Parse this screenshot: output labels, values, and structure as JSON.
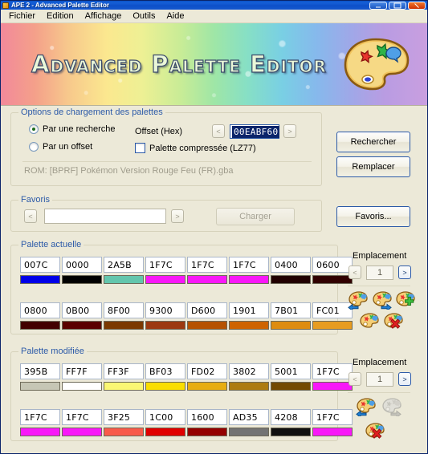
{
  "window": {
    "title": "APE 2 - Advanced Palette Editor",
    "minimize_label": "Minimize",
    "maximize_label": "Maximize",
    "close_label": "Close"
  },
  "menu": [
    {
      "label": "Fichier"
    },
    {
      "label": "Edition"
    },
    {
      "label": "Affichage"
    },
    {
      "label": "Outils"
    },
    {
      "label": "Aide"
    }
  ],
  "banner": {
    "title": "Advanced Palette Editor"
  },
  "options": {
    "legend": "Options de chargement des palettes",
    "radio_search_label": "Par une recherche",
    "radio_offset_label": "Par un offset",
    "offset_label": "Offset (Hex)",
    "offset_value": "00EABF60",
    "offset_prev": "<",
    "offset_next": ">",
    "compressed_label": "Palette compressée (LZ77)",
    "rom_label": "ROM: [BPRF] Pokémon Version Rouge Feu (FR).gba"
  },
  "actions": {
    "search_label": "Rechercher",
    "replace_label": "Remplacer",
    "favorites_label": "Favoris..."
  },
  "favorites": {
    "legend": "Favoris",
    "prev": "<",
    "next": ">",
    "value": "",
    "placeholder": "",
    "load_label": "Charger"
  },
  "current_palette": {
    "legend": "Palette actuelle",
    "emplacement_label": "Emplacement",
    "emplacement_prev": "<",
    "emplacement_value": "1",
    "emplacement_next": ">",
    "swatches": [
      {
        "code": "007C",
        "color": "#0000e8"
      },
      {
        "code": "0000",
        "color": "#000000"
      },
      {
        "code": "2A5B",
        "color": "#63c6ad"
      },
      {
        "code": "1F7C",
        "color": "#f818f8"
      },
      {
        "code": "1F7C",
        "color": "#f818f8"
      },
      {
        "code": "1F7C",
        "color": "#f818f8"
      },
      {
        "code": "0400",
        "color": "#210000"
      },
      {
        "code": "0600",
        "color": "#310000"
      },
      {
        "code": "0800",
        "color": "#420000"
      },
      {
        "code": "0B00",
        "color": "#5a0000"
      },
      {
        "code": "8F00",
        "color": "#7b3900"
      },
      {
        "code": "9300",
        "color": "#9c3910"
      },
      {
        "code": "D600",
        "color": "#b55200"
      },
      {
        "code": "1901",
        "color": "#ce6300"
      },
      {
        "code": "7B01",
        "color": "#de8c10"
      },
      {
        "code": "FC01",
        "color": "#e79c21"
      }
    ],
    "icons": [
      {
        "name": "palette-copy-left-icon",
        "enabled": true
      },
      {
        "name": "palette-copy-right-icon",
        "enabled": true
      },
      {
        "name": "palette-add-icon",
        "enabled": true
      },
      {
        "name": "palette-save-icon",
        "enabled": true
      },
      {
        "name": "palette-delete-icon",
        "enabled": true
      }
    ]
  },
  "modified_palette": {
    "legend": "Palette modifiée",
    "emplacement_label": "Emplacement",
    "emplacement_prev": "<",
    "emplacement_value": "1",
    "emplacement_next": ">",
    "swatches": [
      {
        "code": "395B",
        "color": "#c6c6b5"
      },
      {
        "code": "FF7F",
        "color": "#ffffff"
      },
      {
        "code": "FF3F",
        "color": "#fbf773"
      },
      {
        "code": "BF03",
        "color": "#fade00"
      },
      {
        "code": "FD02",
        "color": "#e7ad10"
      },
      {
        "code": "3802",
        "color": "#ad7b10"
      },
      {
        "code": "5001",
        "color": "#734a00"
      },
      {
        "code": "1F7C",
        "color": "#f818f8"
      },
      {
        "code": "1F7C",
        "color": "#f818f8"
      },
      {
        "code": "1F7C",
        "color": "#f818f8"
      },
      {
        "code": "3F25",
        "color": "#f85a4a"
      },
      {
        "code": "1C00",
        "color": "#e00000"
      },
      {
        "code": "1600",
        "color": "#940000"
      },
      {
        "code": "AD35",
        "color": "#737373"
      },
      {
        "code": "4208",
        "color": "#101010"
      },
      {
        "code": "1F7C",
        "color": "#f818f8"
      }
    ],
    "icons": [
      {
        "name": "palette-copy-left-icon",
        "enabled": true
      },
      {
        "name": "palette-copy-right-icon",
        "enabled": false
      },
      {
        "name": "palette-delete-icon",
        "enabled": true
      }
    ]
  }
}
